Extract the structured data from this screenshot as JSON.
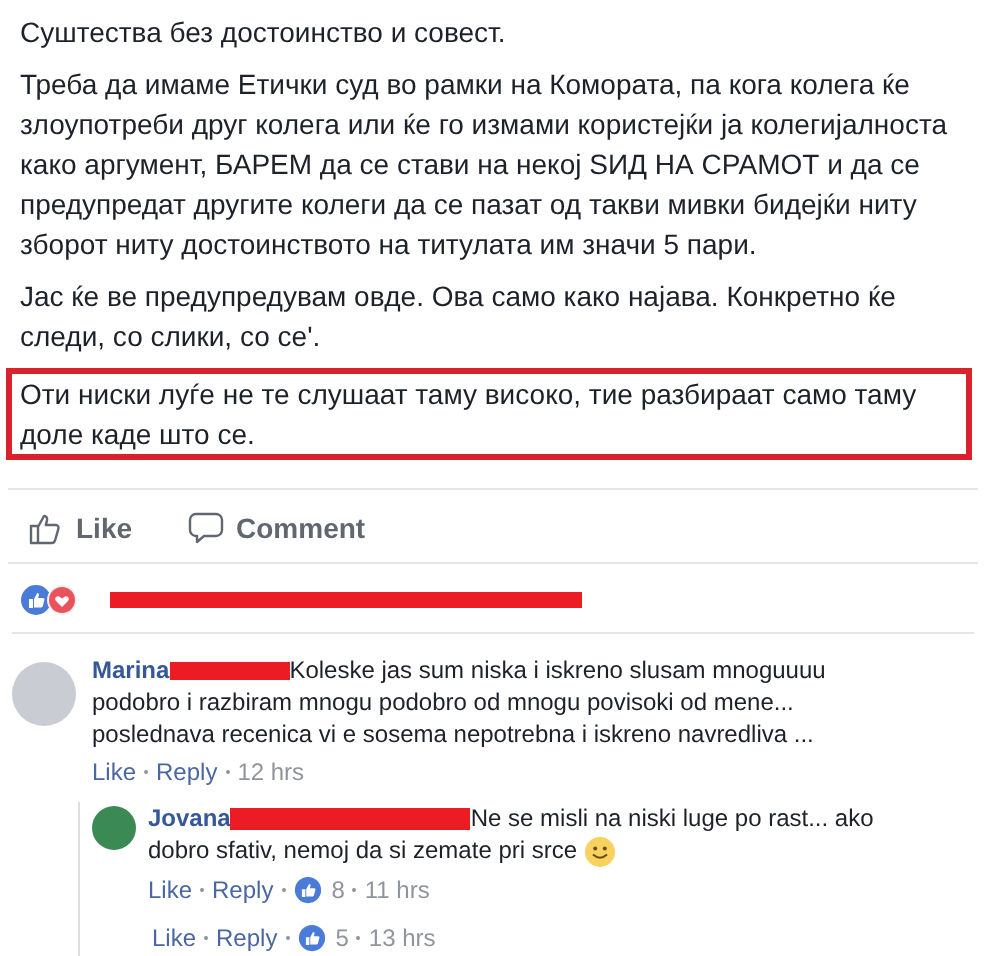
{
  "post": {
    "paragraphs": [
      {
        "text": "Суштества без достоинство и совест.",
        "highlighted": false
      },
      {
        "text": "Треба да имаме Етички суд во рамки на Комората, па кога колега ќе злоупотреби друг колега или ќе го измами користејќи ја колегијалноста како аргумент, БАРЕМ да се стави на некој ЅИД НА СРАМОТ и да се предупредат другите колеги да се пазат од такви мивки бидејќи ниту зборот ниту достоинството на титулата им значи 5 пари.",
        "highlighted": false
      },
      {
        "text": "Јас ќе ве предупредувам овде. Ова само како најава. Конкретно ќе следи, со слики, со се'.",
        "highlighted": false
      },
      {
        "text": "Оти ниски луѓе не те слушаат таму високо, тие разбираат само таму доле каде што се.",
        "highlighted": true
      }
    ]
  },
  "actions": [
    {
      "kind": "like",
      "label": "Like"
    },
    {
      "kind": "comment",
      "label": "Comment"
    }
  ],
  "reactions": {
    "names_redacted": true
  },
  "comments": [
    {
      "name": "Marina",
      "name_redacted": true,
      "text": "Koleske jas sum niska i iskreno slusam mnoguuuu podobro i razbiram mnogu podobro od mnogu povisoki od mene... poslednava recenica vi e sosema nepotrebna i iskreno navredliva ...",
      "like": "Like",
      "reply": "Reply",
      "time": "12 hrs",
      "replies": [
        {
          "name": "Jovana",
          "name_redacted": true,
          "text": "Ne se misli na niski luge po rast... ako dobro sfativ, nemoj da si zemate pri srce",
          "smiley": true,
          "like": "Like",
          "reply": "Reply",
          "likes": "8",
          "time": "11 hrs"
        },
        {
          "like": "Like",
          "reply": "Reply",
          "likes": "5",
          "time": "13 hrs"
        }
      ]
    }
  ]
}
